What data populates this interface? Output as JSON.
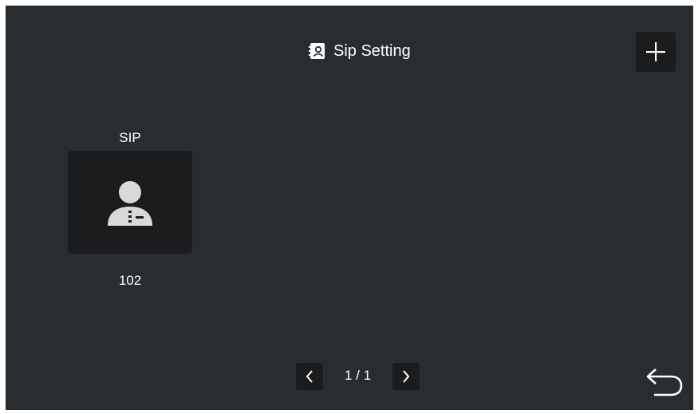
{
  "header": {
    "title": "Sip Setting",
    "title_icon": "contact-book-icon",
    "add_button_icon": "plus-icon"
  },
  "contacts": [
    {
      "label": "SIP",
      "number": "102",
      "icon": "user-avatar-icon"
    }
  ],
  "pagination": {
    "indicator": "1 / 1",
    "prev_icon": "chevron-left-icon",
    "next_icon": "chevron-right-icon"
  },
  "footer": {
    "back_icon": "return-arrow-icon"
  },
  "colors": {
    "background": "#292c31",
    "tile": "#1a1c1e",
    "text": "#ffffff",
    "icon": "#d9d9d9"
  }
}
